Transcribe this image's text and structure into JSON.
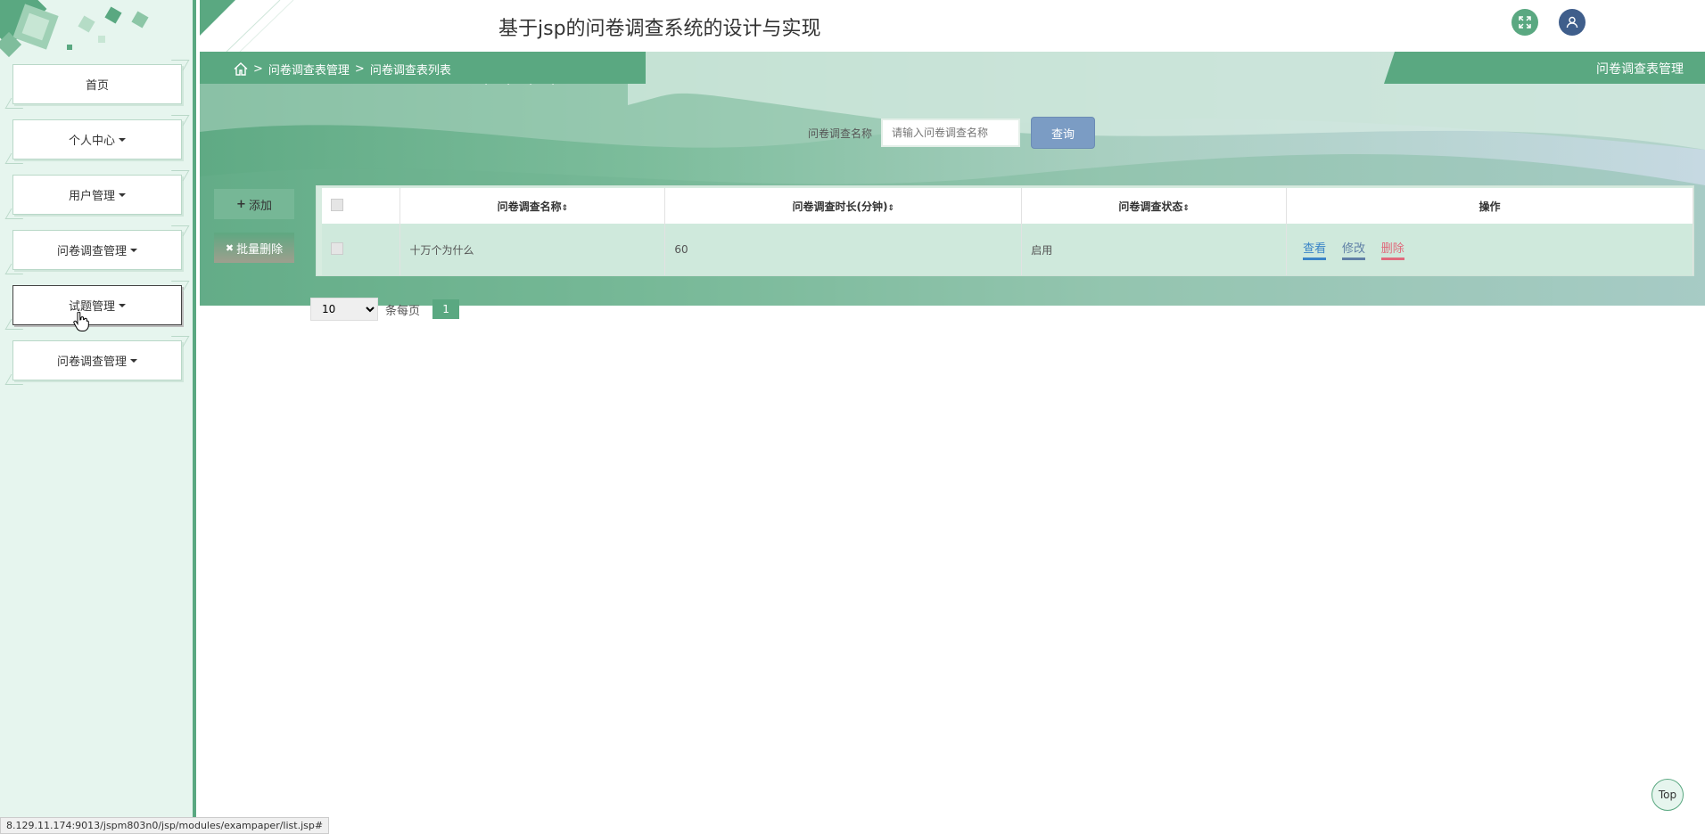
{
  "header": {
    "title": "基于jsp的问卷调查系统的设计与实现"
  },
  "sidebar": {
    "items": [
      {
        "label": "首页",
        "has_caret": false
      },
      {
        "label": "个人中心",
        "has_caret": true
      },
      {
        "label": "用户管理",
        "has_caret": true
      },
      {
        "label": "问卷调查管理",
        "has_caret": true
      },
      {
        "label": "试题管理",
        "has_caret": true
      },
      {
        "label": "问卷调查管理",
        "has_caret": true
      }
    ]
  },
  "breadcrumb": {
    "level1": "问卷调查表管理",
    "level2": "问卷调查表列表",
    "separator": ">"
  },
  "right_tag": "问卷调查表管理",
  "search": {
    "label": "问卷调查名称",
    "placeholder": "请输入问卷调查名称",
    "button": "查询"
  },
  "actions": {
    "add": "添加",
    "batch_delete": "批量删除"
  },
  "table": {
    "columns": [
      "问卷调查名称",
      "问卷调查时长(分钟)",
      "问卷调查状态",
      "操作"
    ],
    "rows": [
      {
        "name": "十万个为什么",
        "duration": "60",
        "status": "启用"
      }
    ],
    "ops": {
      "view": "查看",
      "edit": "修改",
      "delete": "删除"
    }
  },
  "pager": {
    "page_size": "10",
    "per_page_label": "条每页",
    "current_page": "1"
  },
  "top_button": "Top",
  "status_url": "8.129.11.174:9013/jspm803n0/jsp/modules/exampaper/list.jsp#",
  "colors": {
    "primary": "#5aa881",
    "search_button": "#7b9cc4",
    "user_button": "#3f5e8b"
  }
}
